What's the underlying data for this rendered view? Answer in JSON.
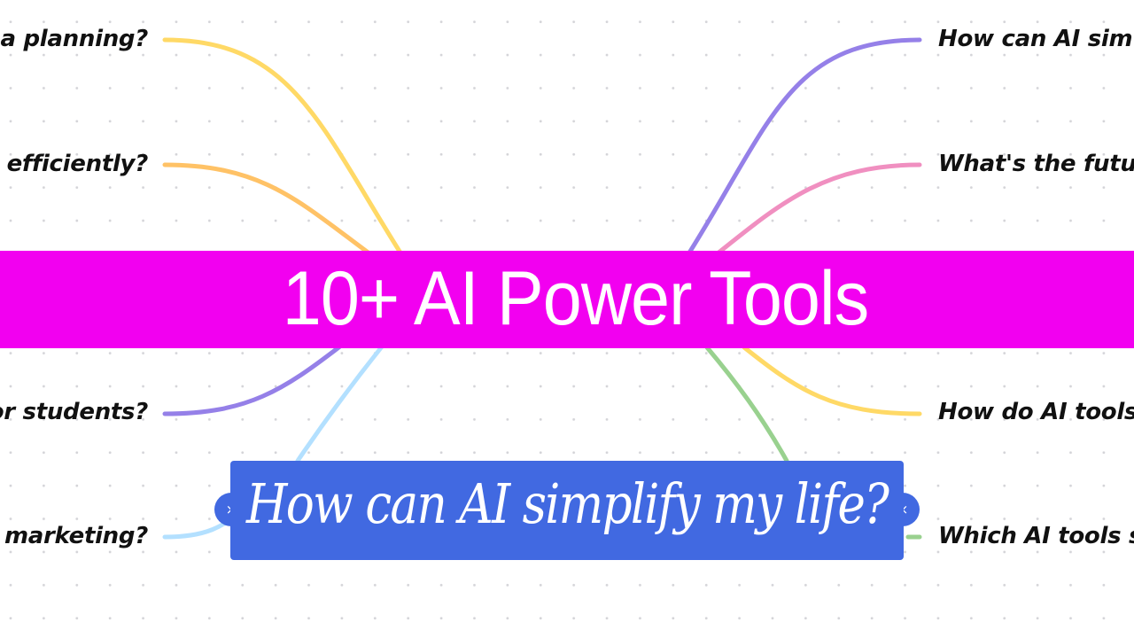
{
  "mindmap": {
    "root": {
      "label": "How can AI simplify my life?",
      "color": "#4169e1",
      "collapse_icon_left": "close-icon",
      "collapse_icon_right": "close-icon",
      "collapse_glyph": "×"
    },
    "left_branches": [
      {
        "label": "a planning?",
        "color": "#ffd966"
      },
      {
        "label": "efficiently?",
        "color": "#ffc266"
      },
      {
        "label": "or students?",
        "color": "#9580e8"
      },
      {
        "label": "marketing?",
        "color": "#b3e0ff"
      }
    ],
    "right_branches": [
      {
        "label": "How can AI sim",
        "color": "#9580e8"
      },
      {
        "label": "What's the futu",
        "color": "#f08fc0"
      },
      {
        "label": "How do AI tools",
        "color": "#ffd966"
      },
      {
        "label": "Which AI tools s",
        "color": "#99d18f"
      }
    ]
  },
  "banner": {
    "title": "10+ AI Power Tools",
    "background": "#f200f0"
  }
}
